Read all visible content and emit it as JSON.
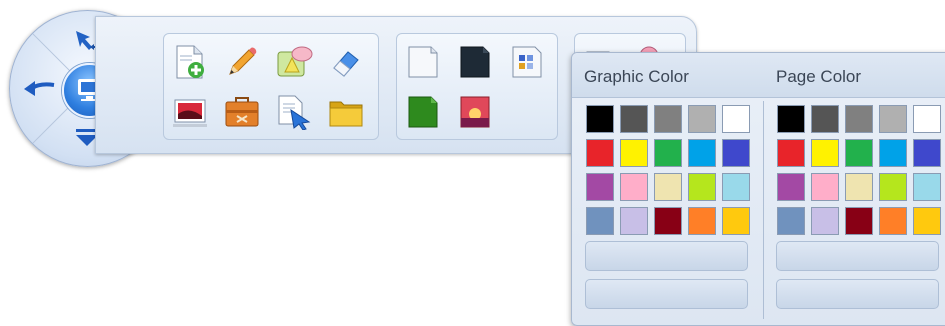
{
  "toolbar": {
    "tools": [
      {
        "name": "new-page-icon"
      },
      {
        "name": "pencil-icon"
      },
      {
        "name": "shapes-icon"
      },
      {
        "name": "eraser-icon"
      },
      {
        "name": "picture-icon"
      },
      {
        "name": "toolbox-icon"
      },
      {
        "name": "select-icon"
      },
      {
        "name": "folder-icon"
      },
      {
        "name": "white-page-icon"
      },
      {
        "name": "dark-page-icon"
      },
      {
        "name": "grid-page-icon"
      },
      {
        "name": "green-page-icon"
      },
      {
        "name": "photo-page-icon"
      }
    ]
  },
  "colors": {
    "palette": [
      "#000000",
      "#555555",
      "#808080",
      "#b0b0b0",
      "#ffffff",
      "#e8242a",
      "#fff200",
      "#22b14c",
      "#00a2e8",
      "#3f48cc",
      "#a349a4",
      "#ffaec9",
      "#efe4b0",
      "#b5e61d",
      "#99d9ea",
      "#7092be",
      "#c8bfe7",
      "#880015",
      "#ff7f27",
      "#ffc90e"
    ]
  },
  "popup": {
    "graphic_title": "Graphic Color",
    "page_title": "Page Color"
  }
}
